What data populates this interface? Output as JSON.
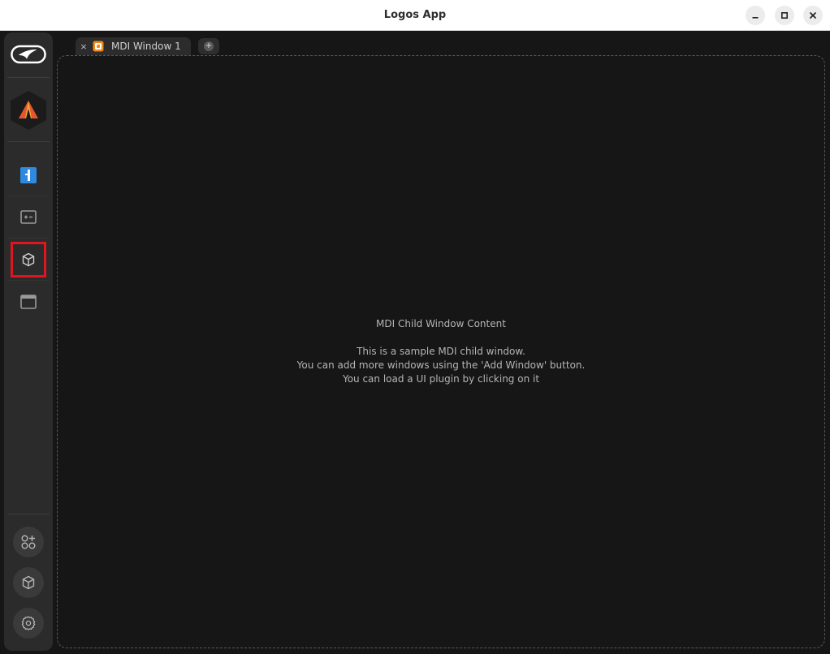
{
  "window": {
    "title": "Logos App",
    "controls": [
      "minimize-icon",
      "maximize-icon",
      "close-icon"
    ]
  },
  "sidebar": {
    "logo_icon": "logos-logo-icon",
    "app_icon": "tent-app-icon",
    "nav_items": [
      {
        "icon": "numbered-box-icon",
        "active": true
      },
      {
        "icon": "terminal-panel-icon"
      },
      {
        "icon": "package-cube-icon",
        "selected": true
      },
      {
        "icon": "browser-window-icon"
      }
    ],
    "bottom_buttons": [
      "apps-add-icon",
      "package-cube-icon",
      "gear-icon"
    ]
  },
  "tabs": [
    {
      "label": "MDI Window 1",
      "close": "×",
      "icon": "plugin-app-icon"
    }
  ],
  "add_tab_symbol": "+",
  "content": {
    "heading": "MDI Child Window Content",
    "lines": [
      "This is a sample MDI child window.",
      "You can add more windows using the 'Add Window' button.",
      "You can load a UI plugin by clicking on it"
    ]
  },
  "colors": {
    "background": "#161616",
    "sidebar": "#2b2b2b",
    "accent_blue": "#2d8ae0",
    "selection_red": "#e0151f",
    "tab_icon_orange": "#f08a1a"
  }
}
